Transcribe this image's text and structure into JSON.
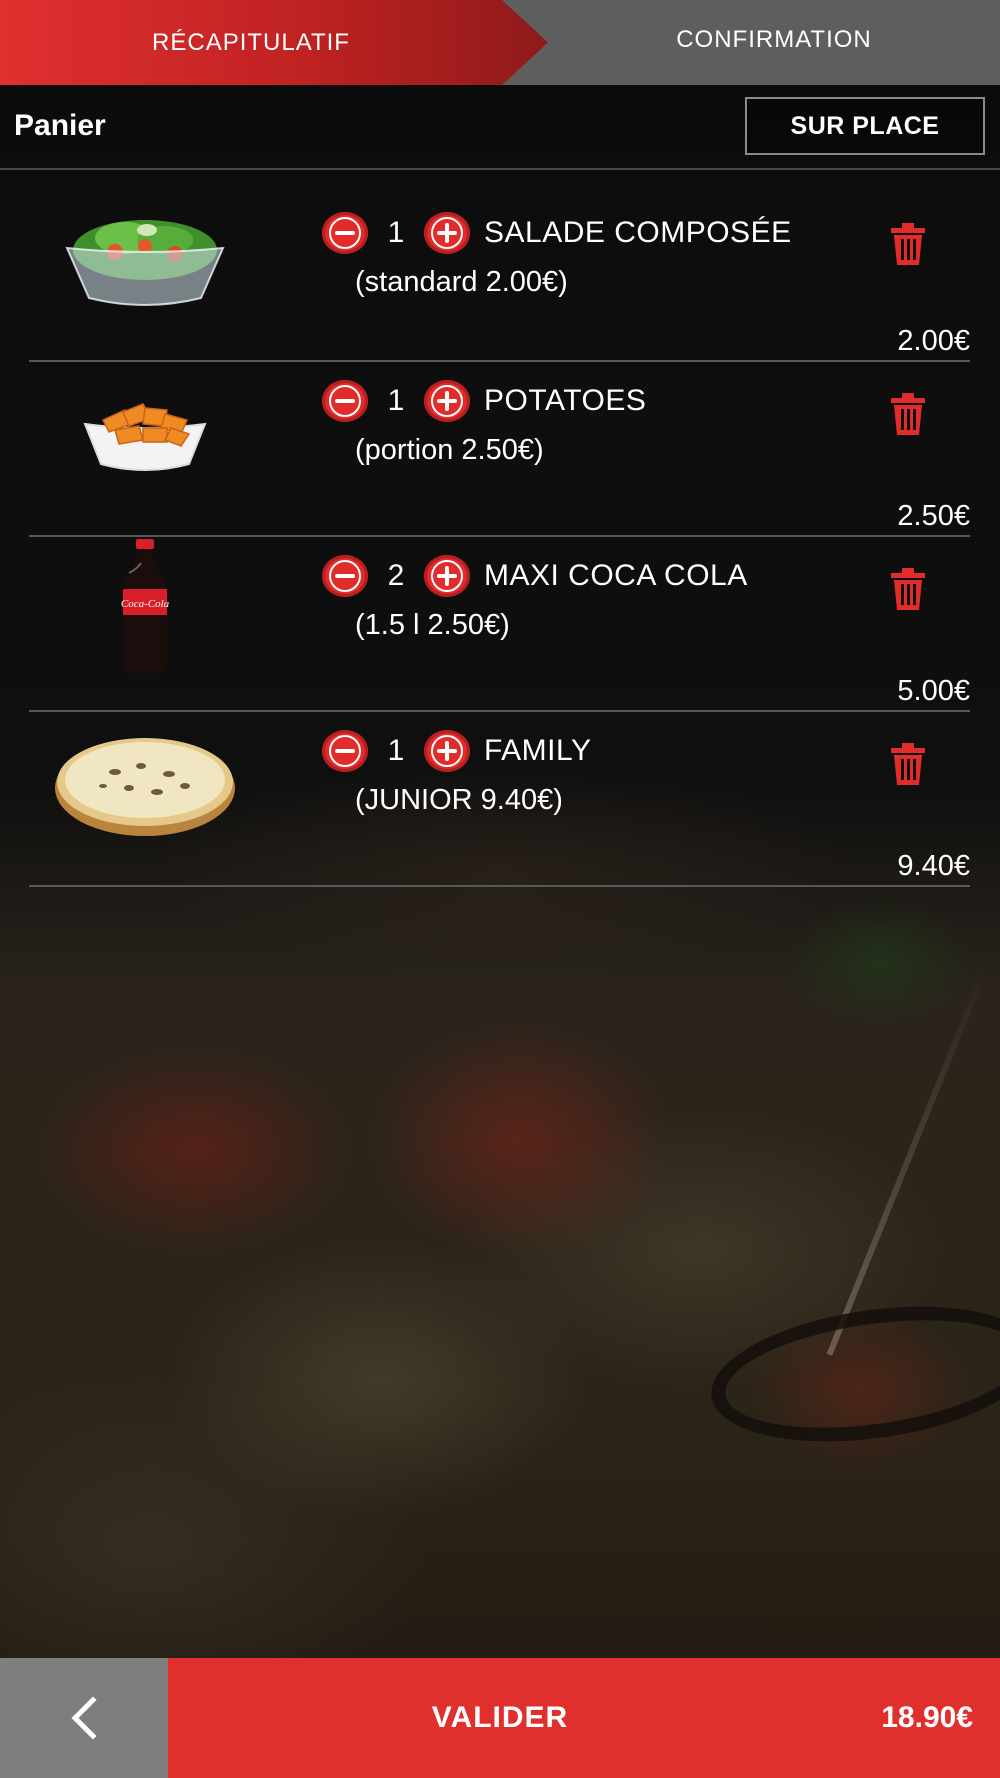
{
  "stepper": {
    "steps": [
      {
        "label": "RÉCAPITULATIF",
        "active": true
      },
      {
        "label": "CONFIRMATION",
        "active": false
      }
    ]
  },
  "panier": {
    "title": "Panier",
    "mode_button": "SUR PLACE"
  },
  "cart": {
    "items": [
      {
        "qty": "1",
        "name": "SALADE COMPOSÉE",
        "variant": "(standard 2.00€)",
        "price": "2.00€",
        "image": "salad-image"
      },
      {
        "qty": "1",
        "name": "POTATOES",
        "variant": "(portion 2.50€)",
        "price": "2.50€",
        "image": "potatoes-image"
      },
      {
        "qty": "2",
        "name": "MAXI COCA COLA",
        "variant": "(1.5 l 2.50€)",
        "price": "5.00€",
        "image": "coca-cola-bottle-image"
      },
      {
        "qty": "1",
        "name": "FAMILY",
        "variant": "(JUNIOR 9.40€)",
        "price": "9.40€",
        "image": "pizza-image"
      }
    ]
  },
  "footer": {
    "back_icon": "chevron-left-icon",
    "validate_label": "VALIDER",
    "total": "18.90€"
  },
  "colors": {
    "accent_red": "#e0302e",
    "inactive_gray": "#5e5e5e",
    "back_gray": "#7e7e7e"
  }
}
